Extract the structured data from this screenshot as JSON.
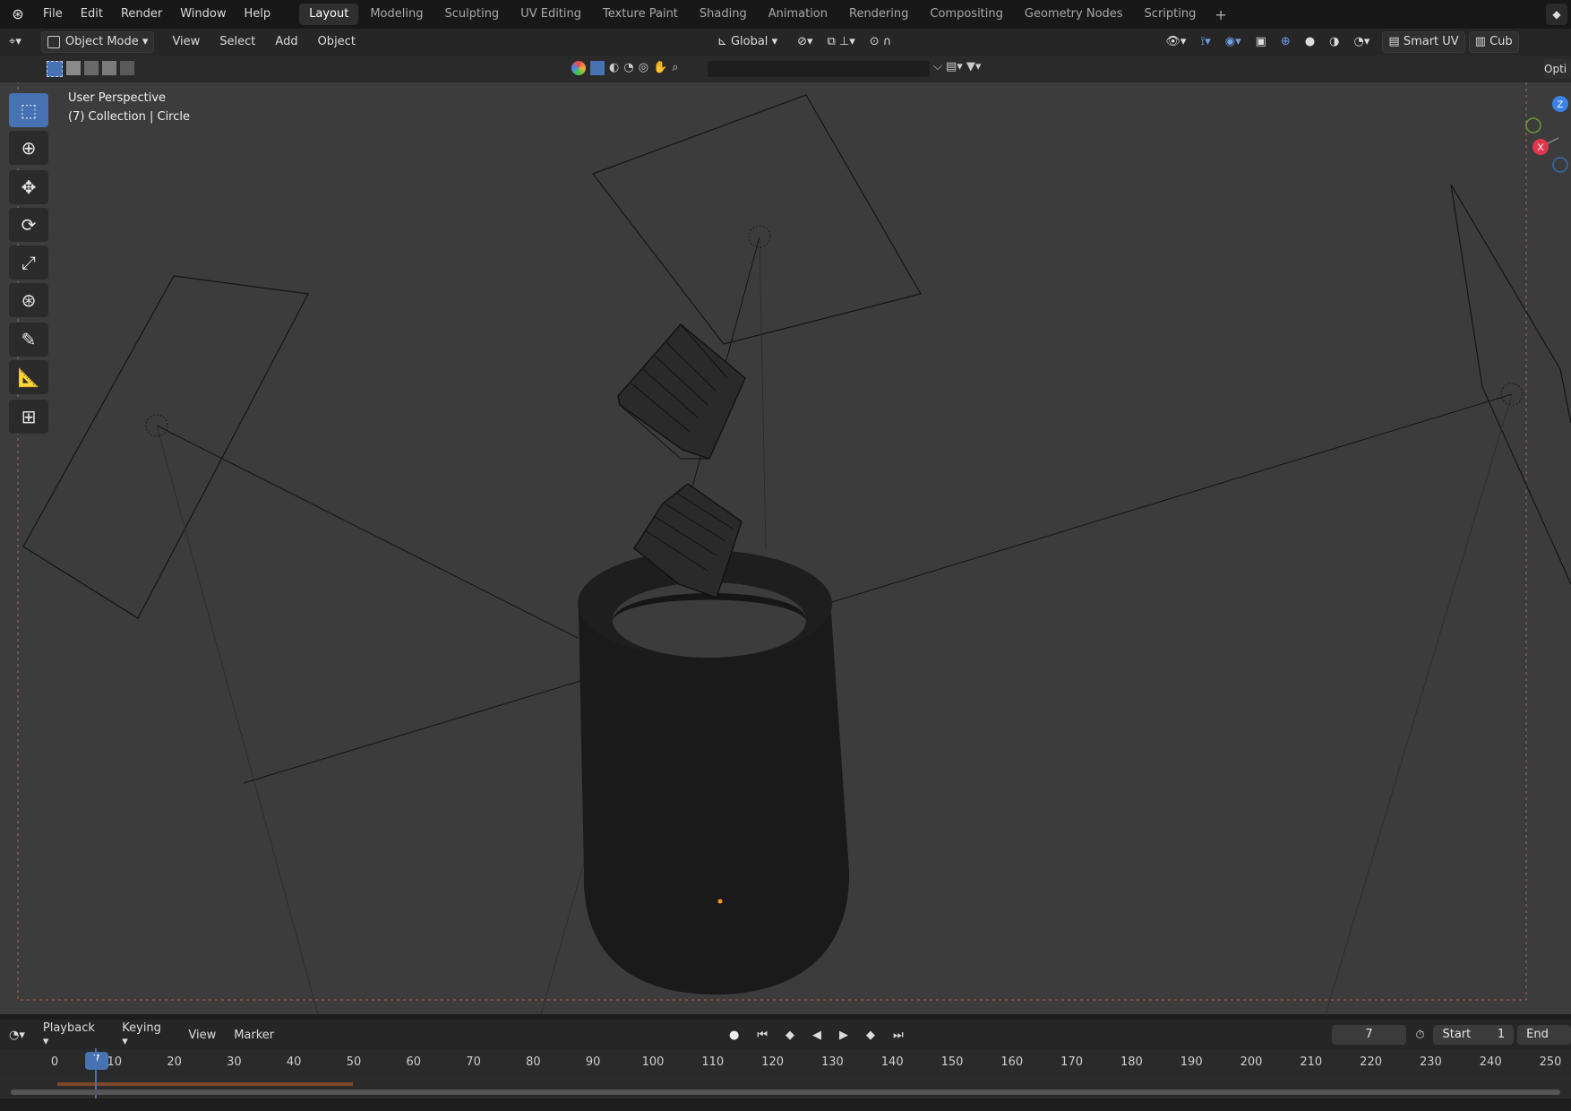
{
  "app_menu": [
    "File",
    "Edit",
    "Render",
    "Window",
    "Help"
  ],
  "workspace_tabs": [
    {
      "label": "Layout",
      "active": true
    },
    {
      "label": "Modeling",
      "active": false
    },
    {
      "label": "Sculpting",
      "active": false
    },
    {
      "label": "UV Editing",
      "active": false
    },
    {
      "label": "Texture Paint",
      "active": false
    },
    {
      "label": "Shading",
      "active": false
    },
    {
      "label": "Animation",
      "active": false
    },
    {
      "label": "Rendering",
      "active": false
    },
    {
      "label": "Compositing",
      "active": false
    },
    {
      "label": "Geometry Nodes",
      "active": false
    },
    {
      "label": "Scripting",
      "active": false
    }
  ],
  "workspace_add": "+",
  "header": {
    "mode": "Object Mode",
    "menus": [
      "View",
      "Select",
      "Add",
      "Object"
    ],
    "orientation": "Global",
    "smart_uv": "Smart UV",
    "cut_label": "Cub",
    "options_label": "Opti"
  },
  "viewport": {
    "perspective_label": "User Perspective",
    "collection_label": "(7) Collection | Circle",
    "gizmo": {
      "z": "Z",
      "x": "X"
    }
  },
  "toolbar": {
    "tools": [
      "select-box",
      "cursor",
      "move",
      "rotate",
      "scale",
      "transform",
      "annotate",
      "measure",
      "add-cube"
    ],
    "active_tool": "select-box"
  },
  "timeline": {
    "menus": [
      "Playback",
      "Keying",
      "View",
      "Marker"
    ],
    "current_frame": "7",
    "start_label": "Start",
    "start_value": "1",
    "end_label": "End",
    "ticks": [
      "0",
      "10",
      "20",
      "30",
      "40",
      "50",
      "60",
      "70",
      "80",
      "90",
      "100",
      "110",
      "120",
      "130",
      "140",
      "150",
      "160",
      "170",
      "180",
      "190",
      "200",
      "210",
      "220",
      "230",
      "240",
      "250"
    ]
  },
  "colors": {
    "accent": "#4772b3",
    "viewport_bg": "#3c3c3c",
    "active_origin": "#ff9a1f"
  }
}
